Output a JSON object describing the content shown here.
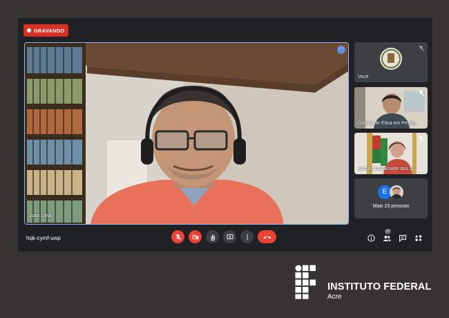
{
  "recording": {
    "label": "GRAVANDO"
  },
  "main_participant": {
    "name": "Joao Lima"
  },
  "participants": [
    {
      "label": "Você"
    },
    {
      "label": "Comitê de Ética em Pesqu..."
    },
    {
      "label": "Andrea Cavalcante dos S..."
    }
  ],
  "more_people": {
    "avatar_letter": "E",
    "label": "Mais 23 pessoas"
  },
  "meeting": {
    "code": "hqk-cymf-uwp"
  },
  "people_count": "27",
  "controls": [
    {
      "name": "mic-off",
      "icon": "mic-off-icon"
    },
    {
      "name": "camera-off",
      "icon": "camera-off-icon"
    },
    {
      "name": "raise-hand",
      "icon": "hand-icon"
    },
    {
      "name": "present",
      "icon": "present-icon"
    },
    {
      "name": "more-options",
      "icon": "more-vertical-icon"
    },
    {
      "name": "leave-call",
      "icon": "phone-hangup-icon"
    }
  ],
  "logo": {
    "title": "INSTITUTO FEDERAL",
    "subtitle": "Acre"
  },
  "colors": {
    "record": "#d93025",
    "control_red": "#ea4335",
    "active_border": "#8ab4f8",
    "meet_bg": "#202124",
    "outer_bg": "#373534"
  }
}
